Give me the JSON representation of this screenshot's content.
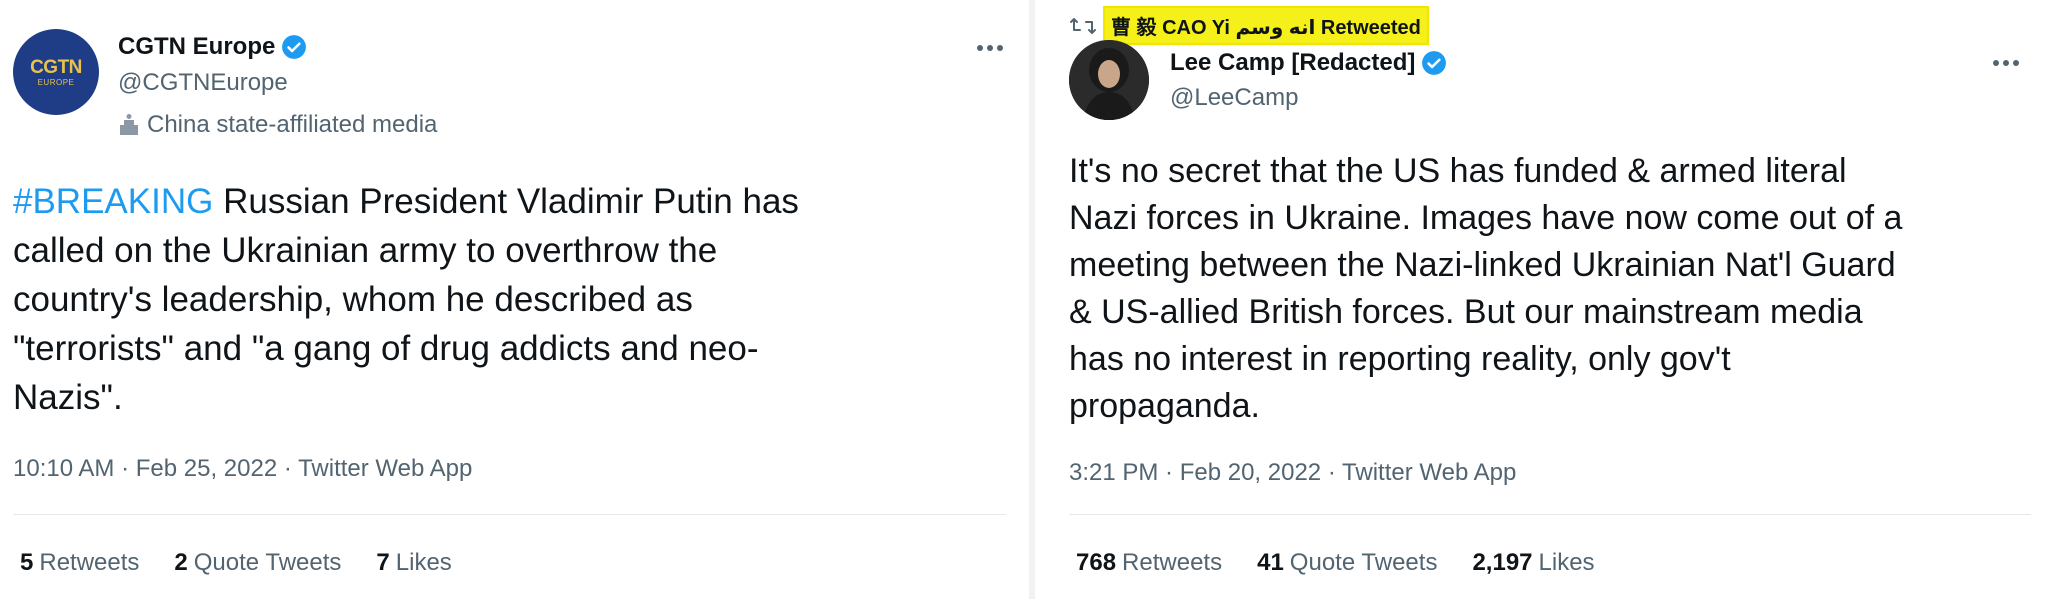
{
  "left_tweet": {
    "avatar_logo_main": "CGTN",
    "avatar_logo_sub": "EUROPE",
    "display_name": "CGTN Europe",
    "handle": "@CGTNEurope",
    "affiliation": "China state-affiliated media",
    "hashtag": "#BREAKING",
    "text": " Russian President Vladimir Putin has\ncalled on the Ukrainian army to overthrow the\ncountry's leadership, whom he described as\n\"terrorists\" and \"a gang of drug addicts and neo-\nNazis\".",
    "meta": "10:10 AM · Feb 25, 2022 · Twitter Web App",
    "stats": {
      "retweets_count": "5",
      "retweets_label": "Retweets",
      "quotes_count": "2",
      "quotes_label": "Quote Tweets",
      "likes_count": "7",
      "likes_label": "Likes"
    }
  },
  "right_tweet": {
    "retweeted_by": "曹 毅 CAO Yi انه وسم Retweeted",
    "display_name": "Lee Camp [Redacted]",
    "handle": "@LeeCamp",
    "text": "It's no secret that the US has funded & armed literal\nNazi forces in Ukraine. Images have now come out of a\nmeeting between the Nazi-linked Ukrainian Nat'l Guard\n& US-allied British forces. But our mainstream media\nhas no interest in reporting reality, only gov't\npropaganda.",
    "meta": "3:21 PM · Feb 20, 2022 · Twitter Web App",
    "stats": {
      "retweets_count": "768",
      "retweets_label": "Retweets",
      "quotes_count": "41",
      "quotes_label": "Quote Tweets",
      "likes_count": "2,197",
      "likes_label": "Likes"
    }
  },
  "colors": {
    "accent": "#1d9bf0",
    "secondary_text": "#536471",
    "highlight": "#f5ef1a",
    "cgtn_blue": "#1f3d86"
  }
}
